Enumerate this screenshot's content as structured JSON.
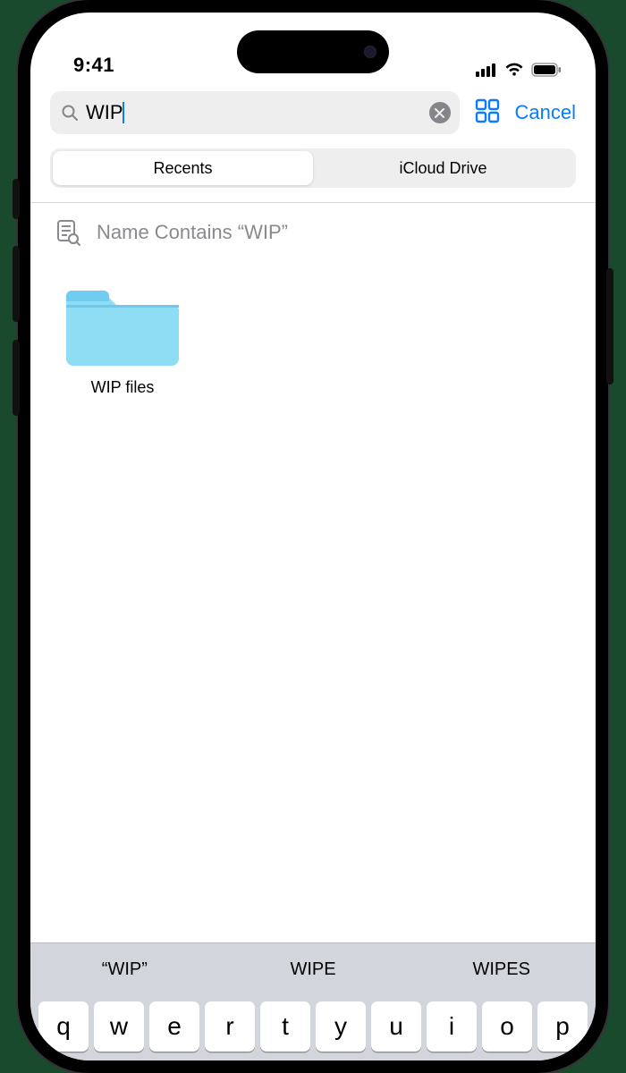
{
  "status": {
    "time": "9:41"
  },
  "search": {
    "query": "WIP",
    "cancel_label": "Cancel"
  },
  "scope": {
    "options": [
      "Recents",
      "iCloud Drive"
    ],
    "active_index": 0
  },
  "filter": {
    "label": "Name Contains “WIP”"
  },
  "results": [
    {
      "name": "WIP files",
      "kind": "folder"
    }
  ],
  "keyboard": {
    "suggestions": [
      "“WIP”",
      "WIPE",
      "WIPES"
    ],
    "row": [
      "q",
      "w",
      "e",
      "r",
      "t",
      "y",
      "u",
      "i",
      "o",
      "p"
    ]
  },
  "colors": {
    "accent": "#0a7aff",
    "folder": "#7dd3f0"
  }
}
